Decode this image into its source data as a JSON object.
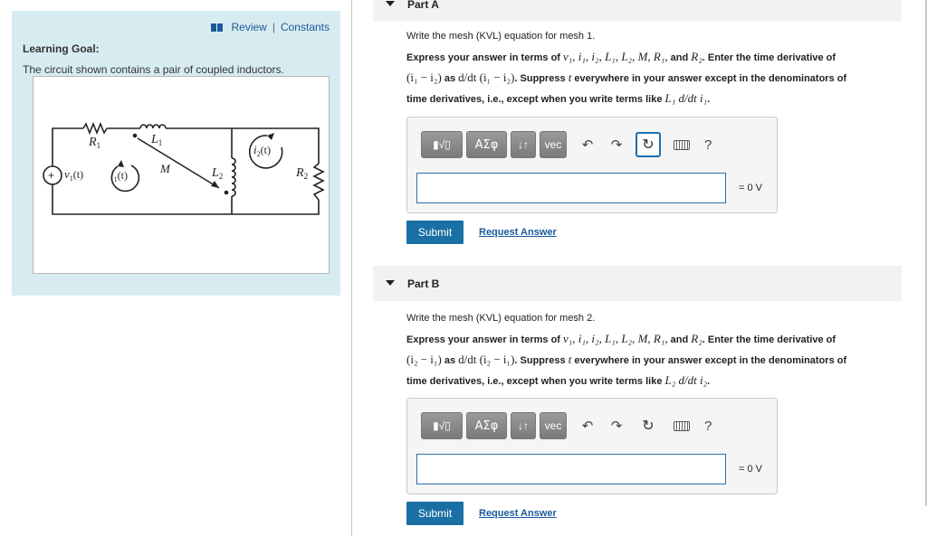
{
  "left": {
    "review_label": "Review",
    "separator": "|",
    "constants_label": "Constants",
    "goal_title": "Learning Goal:",
    "goal_text": "The circuit shown contains a pair of coupled inductors."
  },
  "circuit": {
    "R1": "R",
    "R1_sub": "1",
    "L1": "L",
    "L1_sub": "1",
    "L2": "L",
    "L2_sub": "2",
    "R2": "R",
    "R2_sub": "2",
    "M": "M",
    "plus": "+",
    "v1": "v",
    "v1_sub": "1",
    "v1_arg": "(t)",
    "i1": "i",
    "i1_sub": "1",
    "i1_arg": "(t)",
    "i2": "i",
    "i2_sub": "2",
    "i2_arg": "(t)"
  },
  "parts": [
    {
      "title": "Part A",
      "instruction": "Write the mesh (KVL) equation for mesh 1.",
      "line1_a": "Express your answer in terms of ",
      "line1_vars": "v₁, i₁, i₂, L₁, L₂, M, R₁,",
      "line1_b": " and ",
      "line1_var2": "R₂",
      "line1_c": ". Enter the time derivative of",
      "line2_expr": "(i₁ − i₂)",
      "line2_a": " as ",
      "line2_expr2": "d/dt (i₁ − i₂)",
      "line2_b": ". Suppress ",
      "line2_t": "t",
      "line2_c": " everywhere in your answer except in the denominators of",
      "line3_a": "time derivatives, i.e., except when you write terms like ",
      "line3_expr": "L₁ d/dt i₁",
      "line3_b": ".",
      "eq_label": "= 0 V",
      "submit": "Submit",
      "request": "Request Answer"
    },
    {
      "title": "Part B",
      "instruction": "Write the mesh (KVL) equation for mesh 2.",
      "line1_a": "Express your answer in terms of ",
      "line1_vars": "v₁, i₁, i₂, L₁, L₂, M, R₁,",
      "line1_b": " and ",
      "line1_var2": "R₂",
      "line1_c": ". Enter the time derivative of",
      "line2_expr": "(i₂ − i₁)",
      "line2_a": " as ",
      "line2_expr2": "d/dt (i₂ − i₁)",
      "line2_b": ". Suppress ",
      "line2_t": "t",
      "line2_c": " everywhere in your answer except in the denominators of",
      "line3_a": "time derivatives, i.e., except when you write terms like ",
      "line3_expr": "L₂ d/dt i₂",
      "line3_b": ".",
      "eq_label": "= 0 V",
      "submit": "Submit",
      "request": "Request Answer"
    }
  ],
  "toolbar": {
    "templates_icon": "fraction-sqrt-icon",
    "greek_label": "ΑΣφ",
    "arrows_label": "↓↑",
    "vec_label": "vec",
    "undo_icon": "undo-icon",
    "redo_icon": "redo-icon",
    "reset_icon": "reset-icon",
    "keyboard_icon": "keyboard-icon",
    "help_label": "?"
  }
}
